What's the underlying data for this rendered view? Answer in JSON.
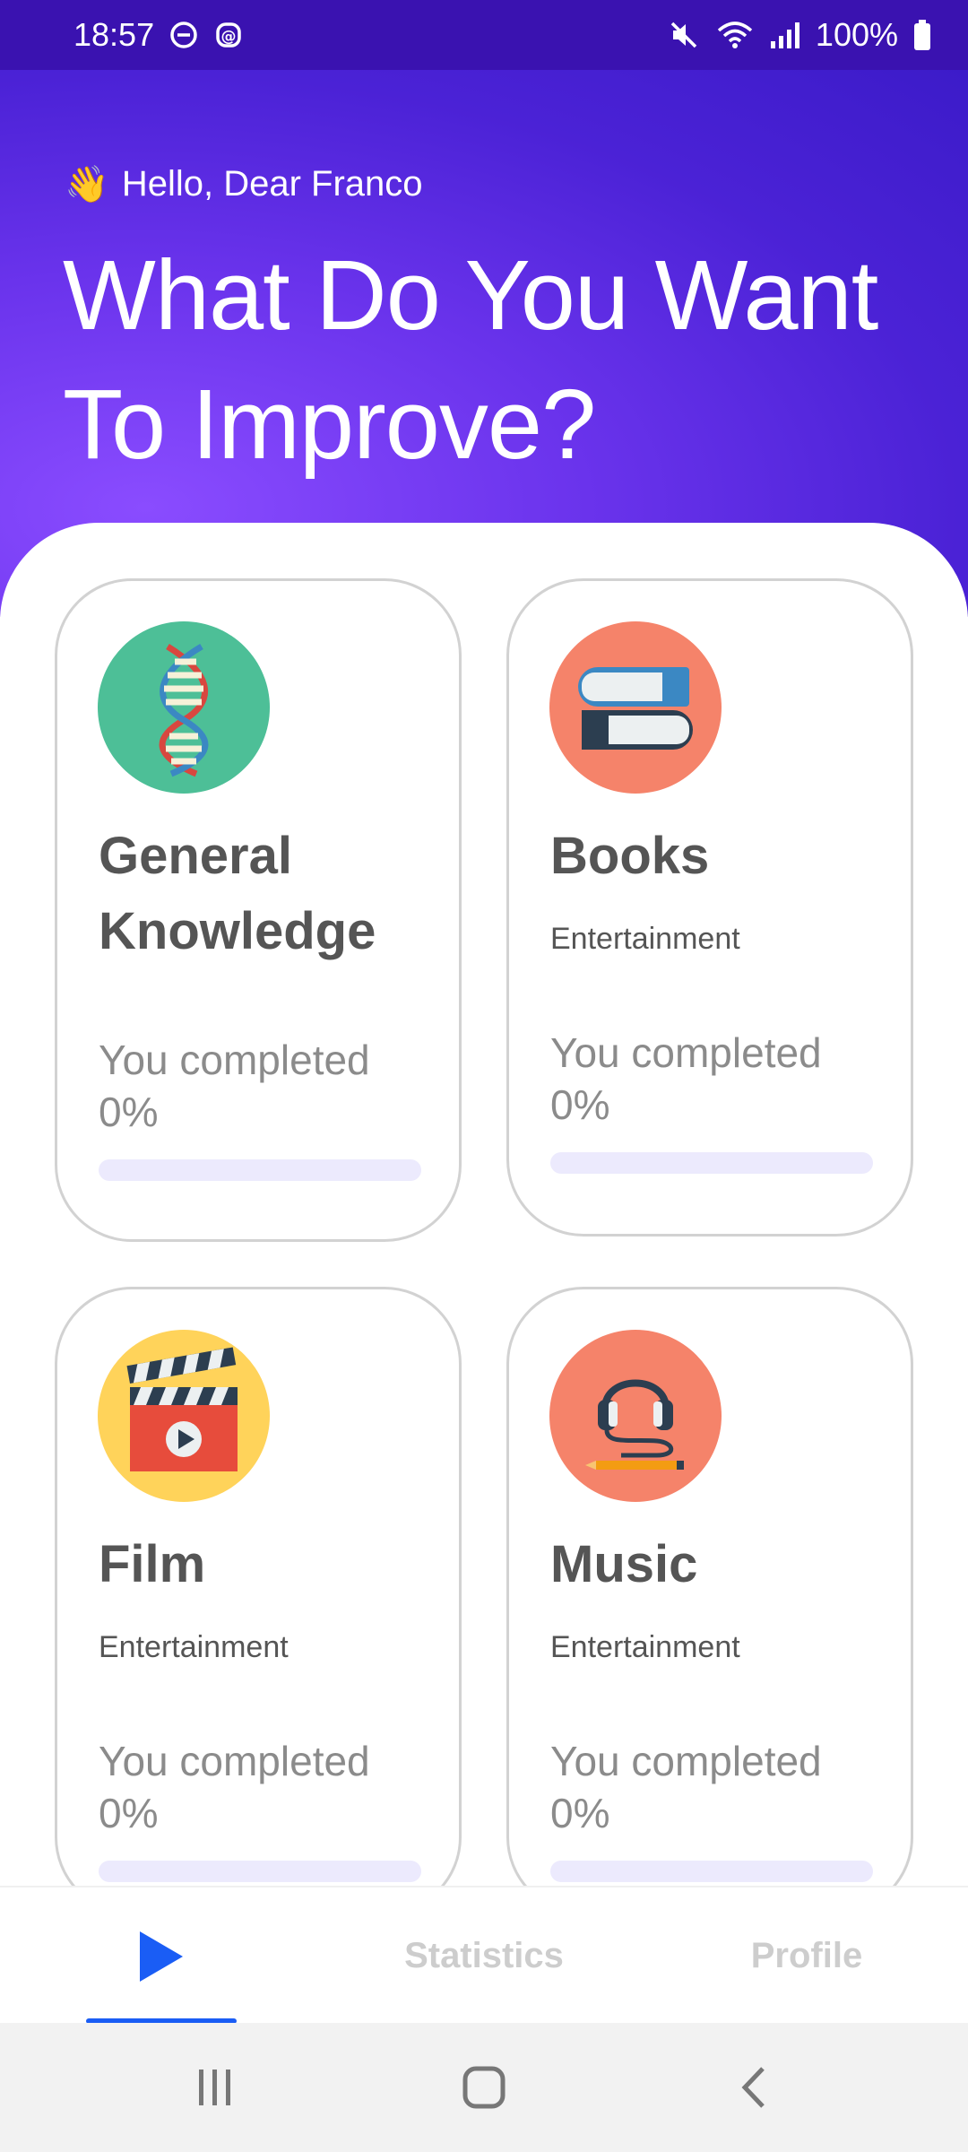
{
  "status_bar": {
    "time": "18:57",
    "battery": "100%"
  },
  "header": {
    "greeting_emoji": "👋",
    "greeting": "Hello, Dear Franco",
    "headline_line1": "What Do You Want",
    "headline_line2": "To Improve?"
  },
  "cards": [
    {
      "title_line1": "General",
      "title_line2": "Knowledge",
      "subtitle": "",
      "progress_label": "You completed",
      "progress_value": "0%",
      "progress_fraction": 0,
      "icon": "dna-icon",
      "icon_bg": "#4dbf97"
    },
    {
      "title_line1": "Books",
      "subtitle": "Entertainment",
      "progress_label": "You completed",
      "progress_value": "0%",
      "progress_fraction": 0,
      "icon": "books-icon",
      "icon_bg": "#f5836a"
    },
    {
      "title_line1": "Film",
      "subtitle": "Entertainment",
      "progress_label": "You completed",
      "progress_value": "0%",
      "progress_fraction": 0,
      "icon": "clapperboard-icon",
      "icon_bg": "#ffd35a"
    },
    {
      "title_line1": "Music",
      "subtitle": "Entertainment",
      "progress_label": "You completed",
      "progress_value": "0%",
      "progress_fraction": 0,
      "icon": "headphones-icon",
      "icon_bg": "#f5836a"
    }
  ],
  "tabs": {
    "play_icon": "play-icon",
    "statistics": "Statistics",
    "profile": "Profile",
    "active_color": "#1a5df5"
  },
  "colors": {
    "header_gradient_start": "#8a4cff",
    "header_gradient_end": "#3c1bc9",
    "title_text": "#555555",
    "progress_track": "#eceafd"
  }
}
